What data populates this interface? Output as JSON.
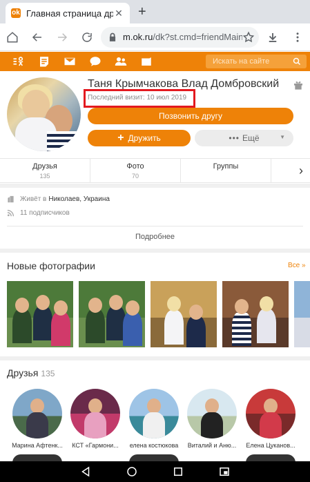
{
  "browser": {
    "tab_title": "Главная страница друга",
    "tab_favicon": "ok-logo-icon",
    "url_domain": "m.ok.ru",
    "url_path": "/dk?st.cmd=friendMain&s"
  },
  "header": {
    "search_placeholder": "Искать на сайте",
    "accent_color": "#ee8208"
  },
  "profile": {
    "name": "Таня Крымчакова Влад Домбровский",
    "last_visit": "Последний визит: 10 июл 2019",
    "call_button": "Позвонить другу",
    "friend_button": "Дружить",
    "more_button": "Ещё",
    "highlight_color": "#e3191f"
  },
  "stats": [
    {
      "name": "Друзья",
      "count": "135"
    },
    {
      "name": "Фото",
      "count": "70"
    },
    {
      "name": "Группы",
      "count": ""
    }
  ],
  "info": {
    "lives_label": "Живёт в",
    "lives_value": "Николаев, Украина",
    "subscribers": "11 подписчиков",
    "more_link": "Подробнее"
  },
  "photos": {
    "title": "Новые фотографии",
    "all_link": "Все »"
  },
  "friends": {
    "title": "Друзья",
    "count": "135",
    "items": [
      {
        "name": "Марина Афтенк..."
      },
      {
        "name": "КСТ «Гармони..."
      },
      {
        "name": "елена костюкова"
      },
      {
        "name": "Виталий и Аню..."
      },
      {
        "name": "Елена Цуканов..."
      }
    ]
  }
}
